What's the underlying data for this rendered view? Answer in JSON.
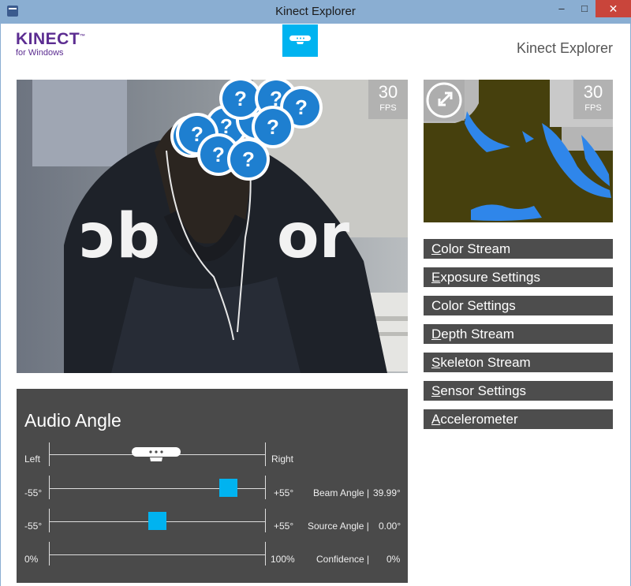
{
  "window": {
    "title": "Kinect Explorer",
    "minimize": "–",
    "maximize": "□",
    "close": "✕"
  },
  "header": {
    "logo_main": "KINECT",
    "logo_tm": "™",
    "logo_sub": "for Windows",
    "app_name": "Kinect Explorer"
  },
  "color_view": {
    "fps_value": "30",
    "fps_label": "FPS",
    "face_marker_glyph": "?"
  },
  "depth_view": {
    "fps_value": "30",
    "fps_label": "FPS",
    "toggle_icon": "expand-collapse-icon"
  },
  "menu": [
    {
      "key": "C",
      "rest": "olor Stream"
    },
    {
      "key": "E",
      "rest": "xposure Settings"
    },
    {
      "key": "",
      "rest": "Color Settings"
    },
    {
      "key": "D",
      "rest": "epth Stream"
    },
    {
      "key": "S",
      "rest": "keleton Stream"
    },
    {
      "key": "S",
      "rest": "ensor Settings"
    },
    {
      "key": "A",
      "rest": "ccelerometer"
    }
  ],
  "audio": {
    "title": "Audio Angle",
    "left_label": "Left",
    "right_label": "Right",
    "beam": {
      "min": "-55°",
      "max": "+55°",
      "label": "Beam Angle |",
      "value": "39.99°",
      "level": 0.83
    },
    "source": {
      "min": "-55°",
      "max": "+55°",
      "label": "Source Angle |",
      "value": "0.00°",
      "level": 0.5
    },
    "confidence": {
      "min": "0%",
      "max": "100%",
      "label": "Confidence |",
      "value": "0%"
    }
  },
  "colors": {
    "accent": "#00b3f0",
    "logo": "#5c2d91",
    "panel": "#4a4a4a",
    "button": "#4d4d4d",
    "depth_bg": "#46400d",
    "depth_player": "#2f86ea",
    "marker": "#1e7fd0"
  }
}
